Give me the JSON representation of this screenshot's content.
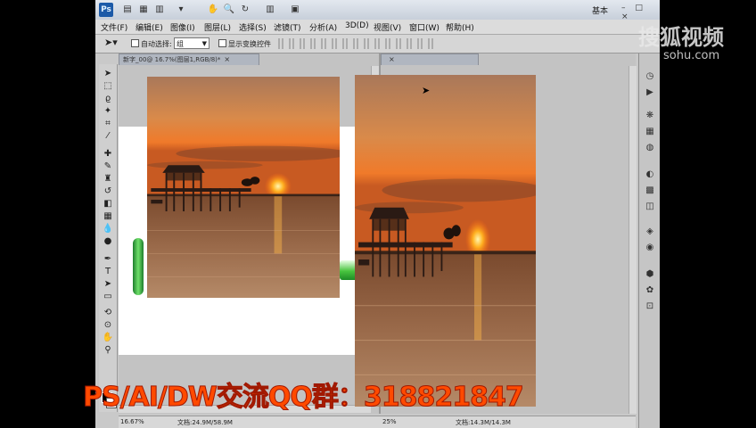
{
  "app_logo": "Ps",
  "workspace_label": "基本",
  "window_controls": "– □ ×",
  "menu": [
    "文件(F)",
    "编辑(E)",
    "图像(I)",
    "图层(L)",
    "选择(S)",
    "滤镜(T)",
    "分析(A)",
    "3D(D)",
    "视图(V)",
    "窗口(W)",
    "帮助(H)"
  ],
  "options": {
    "auto_select_label": "自动选择:",
    "auto_select_value": "组",
    "show_transform_label": "显示变换控件"
  },
  "documents": [
    {
      "tab": "新字_00@ 16.7%(图层1,RGB/8)*",
      "zoom": "16.67%",
      "doc_size": "文档:24.9M/58.9M"
    },
    {
      "tab": "",
      "zoom": "25%",
      "doc_size": "文档:14.3M/14.3M"
    }
  ],
  "overlay_text": "PS/AI/DW交流QQ群：318821847",
  "watermark": {
    "name": "搜狐视频",
    "url": "sohu.com"
  },
  "colors": {
    "banner": "#ff4a00",
    "ps_blue": "#1c5aa8"
  }
}
